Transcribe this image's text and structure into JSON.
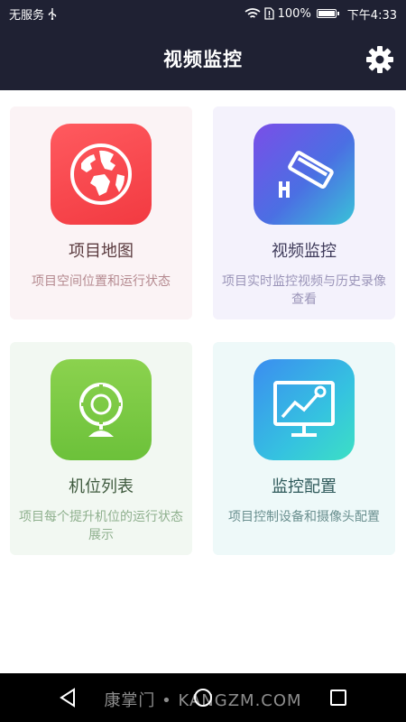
{
  "status_bar": {
    "carrier": "无服务",
    "usb_icon": "usb-icon",
    "battery": "100%",
    "time": "下午4:33",
    "icons": [
      "wifi-icon",
      "alert-sim-icon",
      "battery-icon"
    ]
  },
  "app_bar": {
    "title": "视频监控",
    "settings_icon": "gear-icon"
  },
  "cards": [
    {
      "icon": "globe-icon",
      "title": "项目地图",
      "desc": "项目空间位置和运行状态",
      "color": "#f23a41"
    },
    {
      "icon": "cctv-camera-icon",
      "title": "视频监控",
      "desc": "项目实时监控视频与历史录像查看",
      "color": "#5b63e6"
    },
    {
      "icon": "webcam-icon",
      "title": "机位列表",
      "desc": "项目每个提升机位的运行状态展示",
      "color": "#6cc13a"
    },
    {
      "icon": "monitor-chart-icon",
      "title": "监控配置",
      "desc": "项目控制设备和摄像头配置",
      "color": "#35c2e0"
    }
  ],
  "nav_bar": {
    "back_icon": "back-triangle-icon",
    "home_icon": "home-circle-icon",
    "recents_icon": "recents-square-icon"
  },
  "watermark": "康掌门 • KANGZM.COM"
}
